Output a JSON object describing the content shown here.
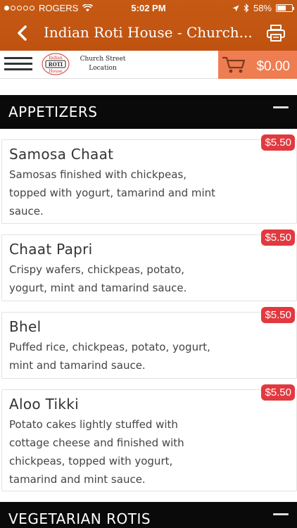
{
  "status_bar": {
    "carrier": "ROGERS",
    "time": "5:02 PM",
    "battery": "58%",
    "battery_level": 0.58
  },
  "nav": {
    "title": "Indian Roti House - Church..."
  },
  "header": {
    "logo_text": [
      "Indian",
      "ROTI",
      "House"
    ],
    "location_line1": "Church Street",
    "location_line2": "Location",
    "cart_total": "$0.00"
  },
  "sections": [
    {
      "title": "APPETIZERS",
      "items": [
        {
          "name": "Samosa Chaat",
          "description": "Samosas finished with chickpeas, topped with yogurt, tamarind and mint sauce.",
          "price": "$5.50"
        },
        {
          "name": "Chaat Papri",
          "description": "Crispy wafers, chickpeas, potato, yogurt, mint and tamarind sauce.",
          "price": "$5.50"
        },
        {
          "name": "Bhel",
          "description": "Puffed rice, chickpeas, potato, yogurt, mint and tamarind sauce.",
          "price": "$5.50"
        },
        {
          "name": "Aloo Tikki",
          "description": "Potato cakes lightly stuffed with cottage cheese and finished with chickpeas, topped with yogurt, tamarind and mint sauce.",
          "price": "$5.50"
        }
      ]
    },
    {
      "title": "VEGETARIAN ROTIS",
      "items": []
    }
  ],
  "colors": {
    "nav_background": "#c65a14",
    "cart_background": "#ef7d52",
    "price_badge": "#e1393f",
    "section_header": "#0a0a0a"
  }
}
